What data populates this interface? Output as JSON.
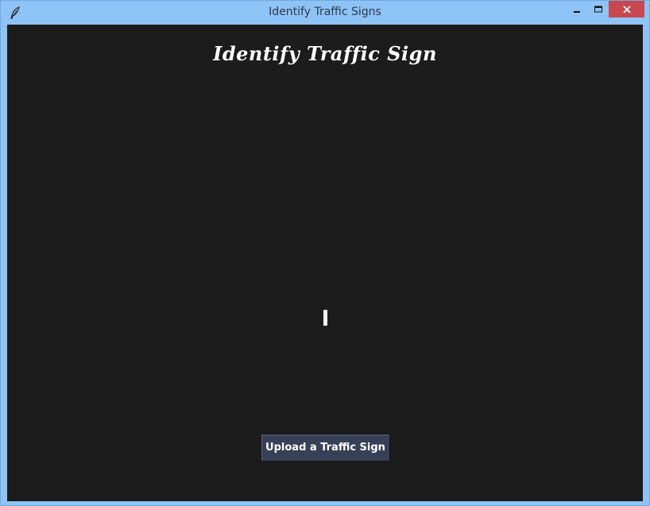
{
  "window": {
    "title": "Identify Traffic Signs",
    "app_icon": "feather-icon",
    "controls": {
      "minimize_icon": "minimize-icon",
      "maximize_icon": "maximize-icon",
      "close_icon": "close-icon"
    },
    "colors": {
      "frame": "#8ec3f5",
      "close_button": "#c7484d"
    }
  },
  "main": {
    "heading": "Identify Traffic Sign",
    "upload_button_label": "Upload a Traffic Sign",
    "colors": {
      "background": "#1c1c1c",
      "button": "#364158",
      "text": "#ffffff"
    }
  }
}
